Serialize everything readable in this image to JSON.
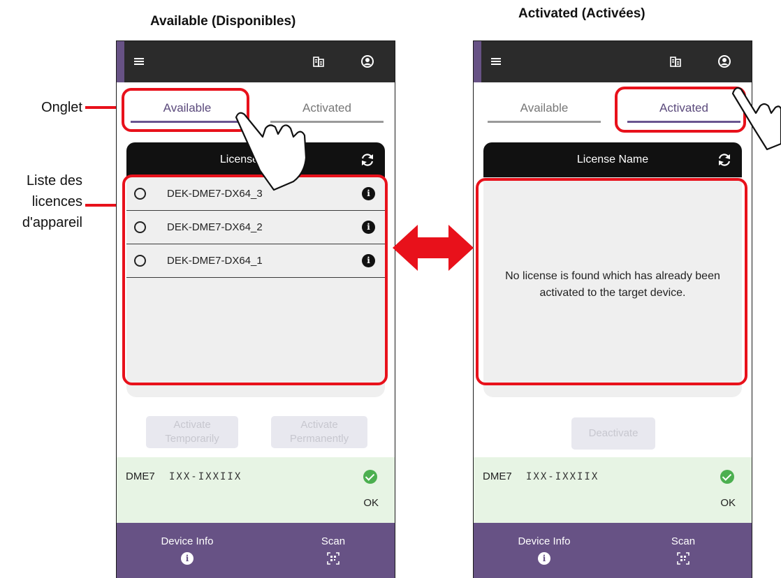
{
  "headings": {
    "available": "Available (Disponibles)",
    "activated": "Activated (Activées)"
  },
  "annotations": {
    "tab_label": "Onglet",
    "list_label": [
      "Liste des",
      "licences",
      "d'appareil"
    ]
  },
  "app": {
    "tabs": [
      "Available",
      "Activated"
    ],
    "list_header": "License Name",
    "licenses": [
      "DEK-DME7-DX64_3",
      "DEK-DME7-DX64_2",
      "DEK-DME7-DX64_1"
    ],
    "empty_message": "No license is found which has already been activated to the target device.",
    "buttons": {
      "activate_temporarily": [
        "Activate",
        "Temporarily"
      ],
      "activate_permanently": [
        "Activate",
        "Permanently"
      ],
      "deactivate": "Deactivate"
    },
    "status": {
      "device": "DME7",
      "serial": "IXX-IXXIIX",
      "result": "OK"
    },
    "nav": {
      "device_info": "Device Info",
      "scan": "Scan"
    }
  },
  "colors": {
    "accent_purple": "#675285",
    "annotation_red": "#e8111b",
    "status_green": "#4caf50",
    "status_bg": "#e7f4e4"
  },
  "icons": [
    "menu-icon",
    "building-icon",
    "user-icon",
    "refresh-icon",
    "info-icon",
    "check-circle-icon",
    "qr-scan-icon",
    "hand-pointer-icon",
    "double-arrow-icon"
  ]
}
